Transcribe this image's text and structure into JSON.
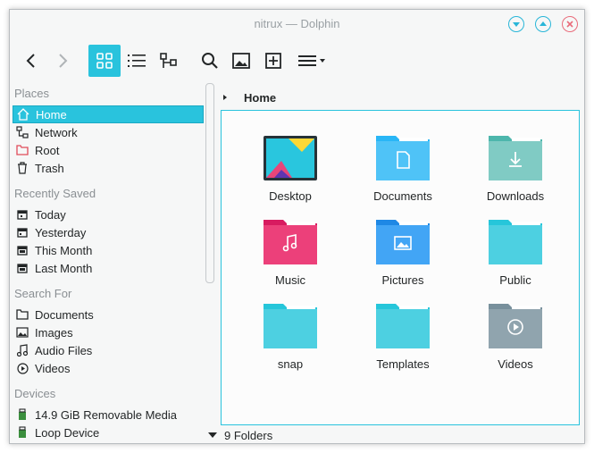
{
  "window": {
    "title": "nitrux — Dolphin"
  },
  "sidebar": {
    "places": {
      "heading": "Places",
      "items": [
        "Home",
        "Network",
        "Root",
        "Trash"
      ]
    },
    "recent": {
      "heading": "Recently Saved",
      "items": [
        "Today",
        "Yesterday",
        "This Month",
        "Last Month"
      ]
    },
    "search": {
      "heading": "Search For",
      "items": [
        "Documents",
        "Images",
        "Audio Files",
        "Videos"
      ]
    },
    "devices": {
      "heading": "Devices",
      "items": [
        "14.9 GiB Removable Media",
        "Loop Device"
      ]
    }
  },
  "breadcrumb": {
    "current": "Home"
  },
  "folders": [
    "Desktop",
    "Documents",
    "Downloads",
    "Music",
    "Pictures",
    "Public",
    "snap",
    "Templates",
    "Videos"
  ],
  "status": {
    "text": "9 Folders"
  },
  "colors": {
    "accent": "#29c3dd",
    "folder": "#4dd0e1",
    "music": "#e8457a",
    "pictures": "#42a5f5",
    "downloads": "#80cbc4",
    "videos": "#90a4ae"
  }
}
